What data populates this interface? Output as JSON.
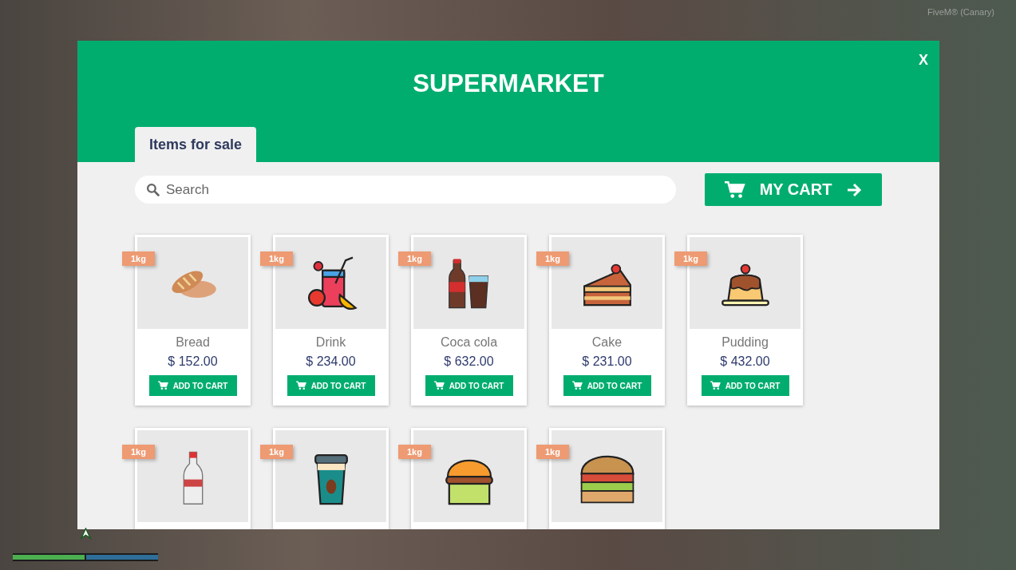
{
  "overlay_label": "FiveM® (Canary)",
  "window": {
    "title": "SUPERMARKET",
    "close": "X"
  },
  "tabs": [
    {
      "label": "Items for sale",
      "selected": true
    }
  ],
  "search": {
    "placeholder": "Search"
  },
  "cart_button": {
    "label": "MY CART"
  },
  "items": [
    {
      "weight": "1kg",
      "name": "Bread",
      "price": "$ 152.00",
      "button": "ADD TO CART"
    },
    {
      "weight": "1kg",
      "name": "Drink",
      "price": "$ 234.00",
      "button": "ADD TO CART"
    },
    {
      "weight": "1kg",
      "name": "Coca cola",
      "price": "$ 632.00",
      "button": "ADD TO CART"
    },
    {
      "weight": "1kg",
      "name": "Cake",
      "price": "$ 231.00",
      "button": "ADD TO CART"
    },
    {
      "weight": "1kg",
      "name": "Pudding",
      "price": "$ 432.00",
      "button": "ADD TO CART"
    },
    {
      "weight": "1kg"
    },
    {
      "weight": "1kg"
    },
    {
      "weight": "1kg"
    },
    {
      "weight": "1kg"
    }
  ]
}
